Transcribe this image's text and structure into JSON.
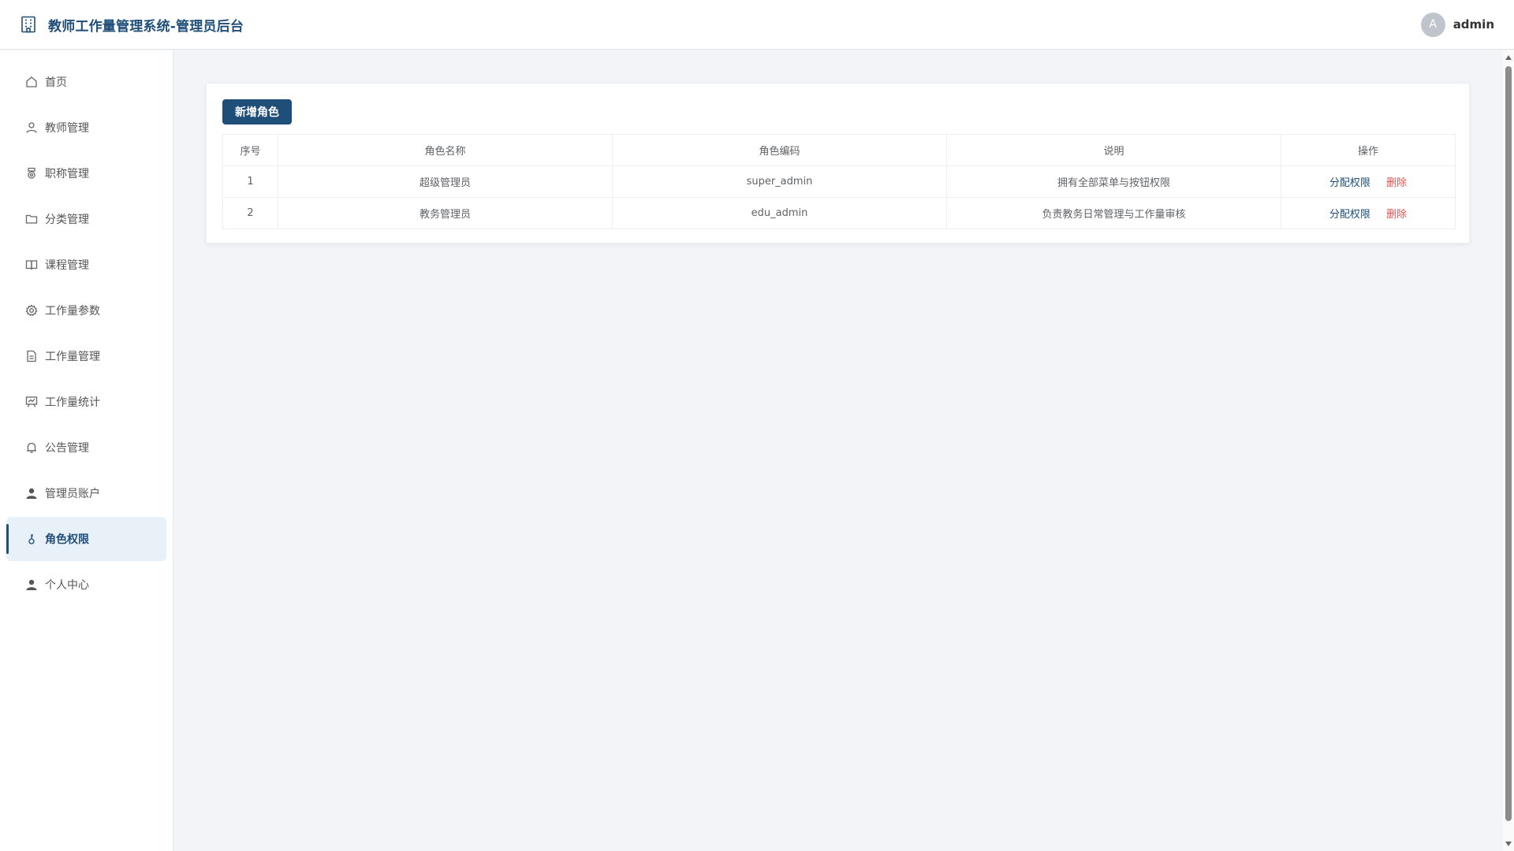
{
  "header": {
    "title": "教师工作量管理系统-管理员后台",
    "avatar_letter": "A",
    "username": "admin"
  },
  "sidebar": {
    "items": [
      {
        "label": "首页",
        "icon": "home-icon"
      },
      {
        "label": "教师管理",
        "icon": "user-icon"
      },
      {
        "label": "职称管理",
        "icon": "badge-icon"
      },
      {
        "label": "分类管理",
        "icon": "folder-icon"
      },
      {
        "label": "课程管理",
        "icon": "book-icon"
      },
      {
        "label": "工作量参数",
        "icon": "gear-icon"
      },
      {
        "label": "工作量管理",
        "icon": "document-icon"
      },
      {
        "label": "工作量统计",
        "icon": "chart-board-icon"
      },
      {
        "label": "公告管理",
        "icon": "bell-icon"
      },
      {
        "label": "管理员账户",
        "icon": "user-filled-icon"
      },
      {
        "label": "角色权限",
        "icon": "key-icon",
        "active": true
      },
      {
        "label": "个人中心",
        "icon": "user-filled-icon"
      }
    ]
  },
  "main": {
    "add_button": "新增角色",
    "table": {
      "columns": [
        "序号",
        "角色名称",
        "角色编码",
        "说明",
        "操作"
      ],
      "rows": [
        {
          "index": "1",
          "name": "超级管理员",
          "code": "super_admin",
          "desc": "拥有全部菜单与按钮权限"
        },
        {
          "index": "2",
          "name": "教务管理员",
          "code": "edu_admin",
          "desc": "负责教务日常管理与工作量审核"
        }
      ],
      "op_assign": "分配权限",
      "op_delete": "删除"
    }
  },
  "colors": {
    "primary": "#1f4e79",
    "danger": "#e15353",
    "active_bg": "#e8f0f8"
  }
}
